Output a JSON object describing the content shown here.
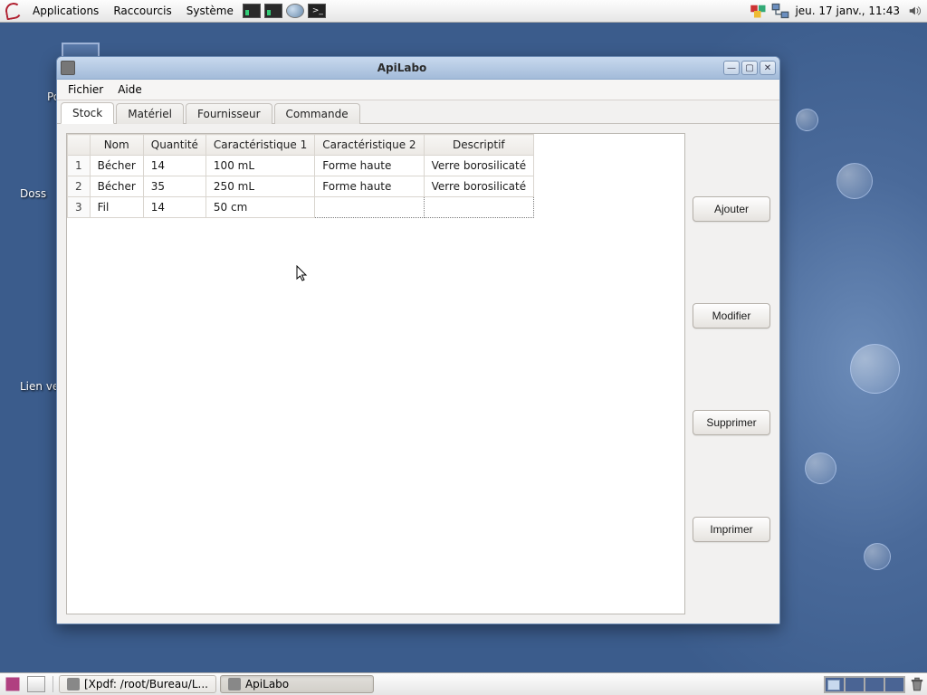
{
  "top_panel": {
    "menus": {
      "apps": "Applications",
      "shortcuts": "Raccourcis",
      "system": "Système"
    },
    "clock": "jeu. 17 janv., 11:43"
  },
  "desktop": {
    "label1": "Po",
    "label2": "Doss",
    "label3": "Lien ve"
  },
  "window": {
    "title": "ApiLabo",
    "menu": {
      "file": "Fichier",
      "help": "Aide"
    },
    "tabs": {
      "stock": "Stock",
      "materiel": "Matériel",
      "fournisseur": "Fournisseur",
      "commande": "Commande"
    },
    "headers": {
      "nom": "Nom",
      "quantite": "Quantité",
      "c1": "Caractéristique 1",
      "c2": "Caractéristique 2",
      "desc": "Descriptif"
    },
    "rows": [
      {
        "n": "1",
        "nom": "Bécher",
        "quantite": "14",
        "c1": "100 mL",
        "c2": "Forme haute",
        "desc": "Verre borosilicaté"
      },
      {
        "n": "2",
        "nom": "Bécher",
        "quantite": "35",
        "c1": "250 mL",
        "c2": "Forme haute",
        "desc": "Verre borosilicaté"
      },
      {
        "n": "3",
        "nom": "Fil",
        "quantite": "14",
        "c1": "50 cm",
        "c2": "",
        "desc": ""
      }
    ],
    "buttons": {
      "add": "Ajouter",
      "modify": "Modifier",
      "delete": "Supprimer",
      "print": "Imprimer"
    }
  },
  "taskbar": {
    "task1": "[Xpdf: /root/Bureau/L...",
    "task2": "ApiLabo"
  }
}
